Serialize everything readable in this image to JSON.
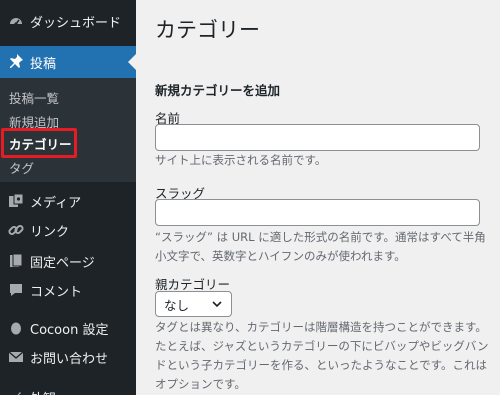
{
  "sidebar": {
    "dashboard": "ダッシュボード",
    "posts": "投稿",
    "submenu": {
      "all_posts": "投稿一覧",
      "add_new": "新規追加",
      "categories": "カテゴリー",
      "tags": "タグ"
    },
    "media": "メディア",
    "links": "リンク",
    "pages": "固定ページ",
    "comments": "コメント",
    "cocoon": "Cocoon 設定",
    "contact": "お問い合わせ",
    "appearance": "外観"
  },
  "main": {
    "title": "カテゴリー",
    "form_heading": "新規カテゴリーを追加",
    "name_label": "名前",
    "name_value": "",
    "name_desc": "サイト上に表示される名前です。",
    "slug_label": "スラッグ",
    "slug_value": "",
    "slug_desc": "“スラッグ” は URL に適した形式の名前です。通常はすべて半角小文字で、英数字とハイフンのみが使われます。",
    "parent_label": "親カテゴリー",
    "parent_selected": "なし",
    "parent_desc": "タグとは異なり、カテゴリーは階層構造を持つことができます。たとえば、ジャズというカテゴリーの下にビバップやビッグバンドという子カテゴリーを作る、といったようなことです。これはオプションです。"
  },
  "colors": {
    "sidebar_bg": "#1d2327",
    "submenu_bg": "#2c3338",
    "active_bg": "#2271b1",
    "highlight": "#e51c23"
  }
}
